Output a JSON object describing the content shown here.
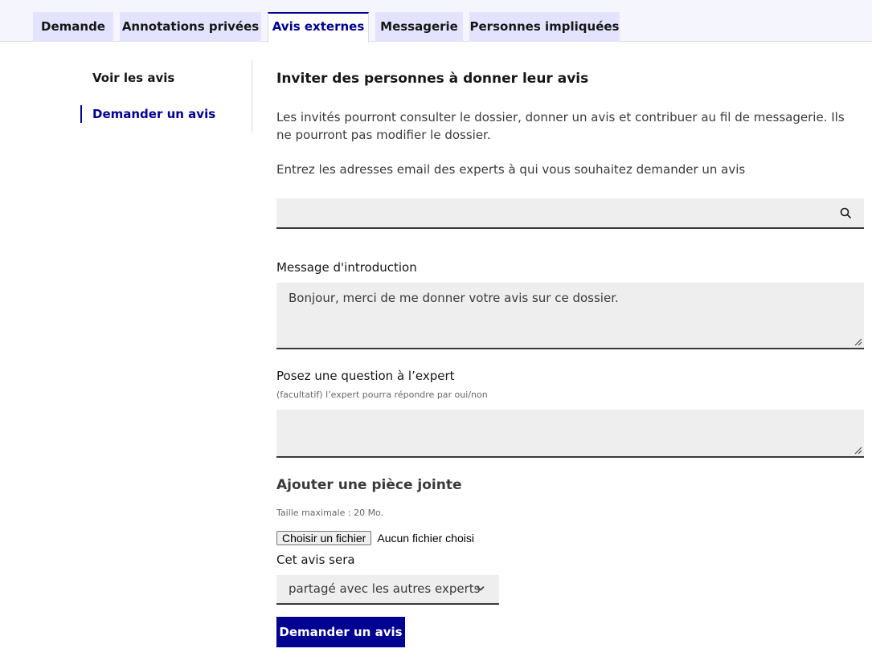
{
  "tabs": [
    {
      "label": "Demande"
    },
    {
      "label": "Annotations privées"
    },
    {
      "label": "Avis externes",
      "active": true
    },
    {
      "label": "Messagerie"
    },
    {
      "label": "Personnes impliquées"
    }
  ],
  "sidemenu": {
    "items": [
      {
        "label": "Voir les avis"
      },
      {
        "label": "Demander un avis",
        "active": true
      }
    ]
  },
  "form": {
    "title": "Inviter des personnes à donner leur avis",
    "intro": "Les invités pourront consulter le dossier, donner un avis et contribuer au fil de messagerie. Ils ne pourront pas modifier le dossier.",
    "emails_label": "Entrez les adresses email des experts à qui vous souhaitez demander un avis",
    "emails_value": "",
    "message_label": "Message d'introduction",
    "message_value": "Bonjour, merci de me donner votre avis sur ce dossier.",
    "question_label": "Posez une question à l’expert",
    "question_hint": "(facultatif) l’expert pourra répondre par oui/non",
    "question_value": "",
    "attachment_title": "Ajouter une pièce jointe",
    "attachment_size_hint": "Taille maximale : 20 Mo.",
    "file_button_label": "Choisir un fichier",
    "file_status": "Aucun fichier choisi",
    "share_label": "Cet avis sera",
    "share_selected": "partagé avec les autres experts",
    "submit_label": "Demander un avis"
  },
  "colors": {
    "accent": "#000091",
    "tab_bg": "#e3e3fd",
    "field_bg": "#eeeeee"
  }
}
